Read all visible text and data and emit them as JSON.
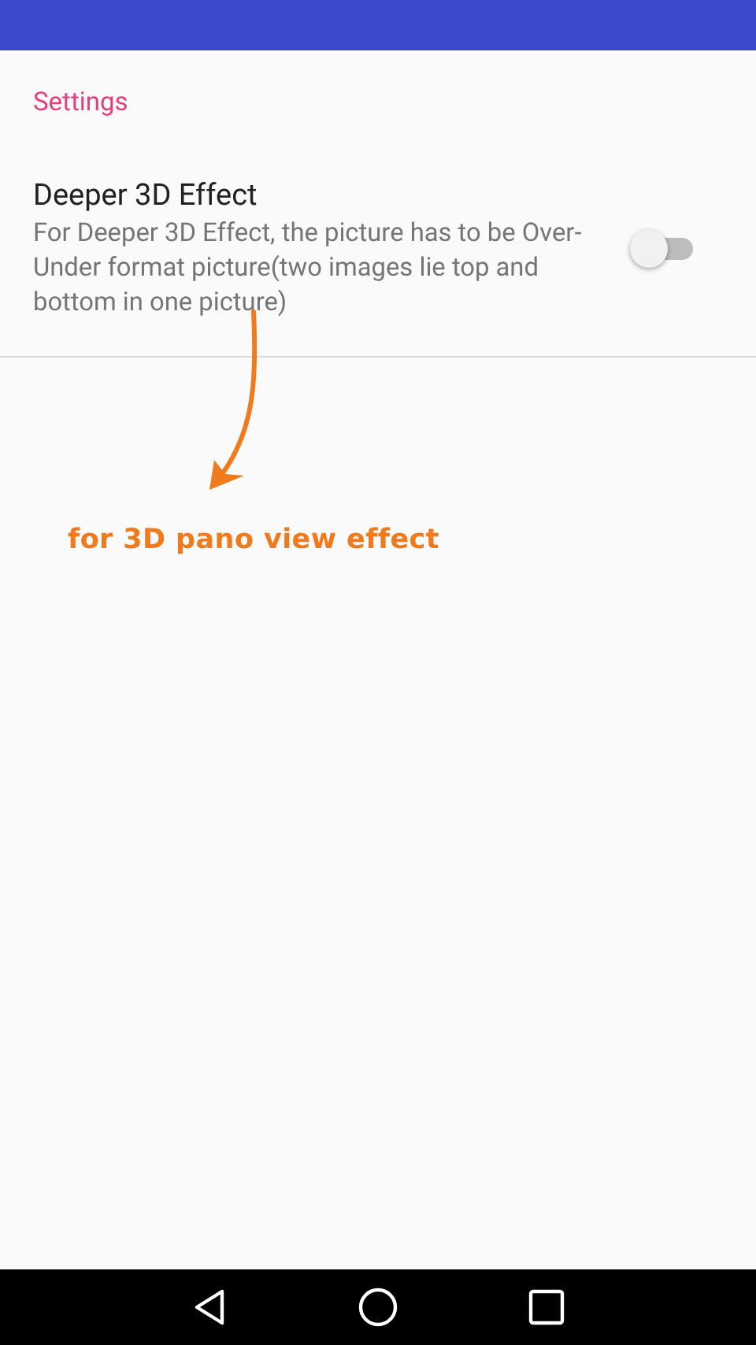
{
  "section": {
    "title": "Settings"
  },
  "preferences": [
    {
      "kind": "switch",
      "title": "Deeper 3D Effect",
      "summary": "For Deeper 3D Effect, the picture has to be Over-Under format picture(two images lie top and bottom in one picture)",
      "on": false
    }
  ],
  "annotation": {
    "text": "for 3D pano view effect"
  }
}
